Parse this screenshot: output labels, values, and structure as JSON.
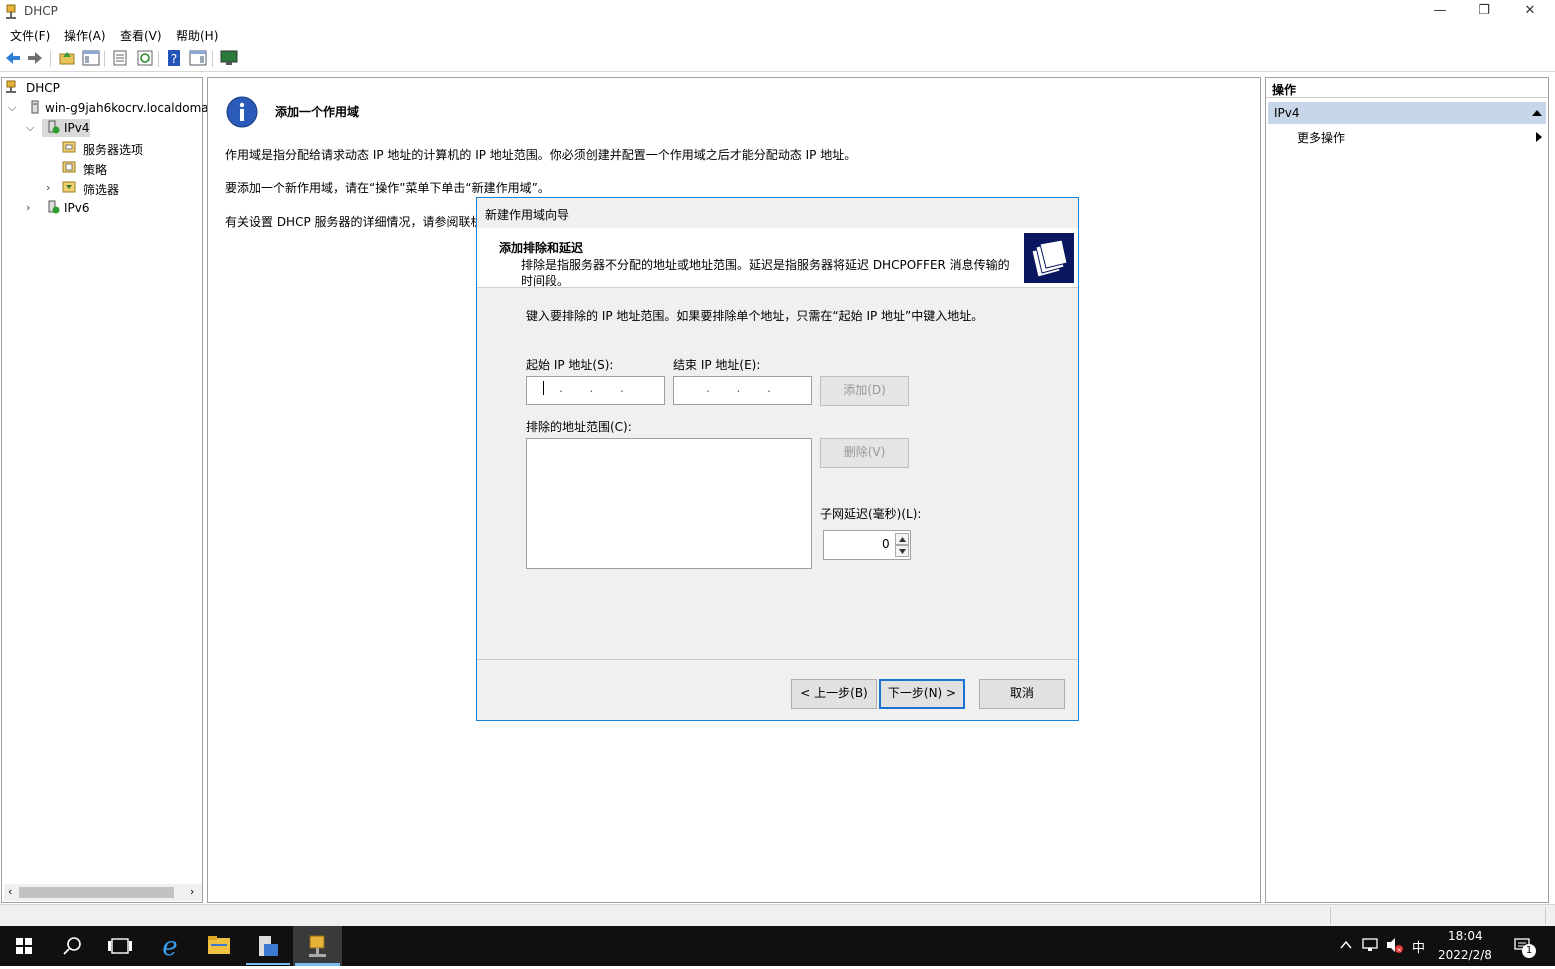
{
  "window": {
    "title": "DHCP",
    "controls": {
      "minimize": "—",
      "restore": "❐",
      "close": "✕"
    }
  },
  "menu": [
    "文件(F)",
    "操作(A)",
    "查看(V)",
    "帮助(H)"
  ],
  "tree": {
    "root": "DHCP",
    "server": "win-g9jah6kocrv.localdoma",
    "ipv4": "IPv4",
    "server_options": "服务器选项",
    "policies": "策略",
    "filters": "筛选器",
    "ipv6": "IPv6"
  },
  "center": {
    "heading": "添加一个作用域",
    "para1": "作用域是指分配给请求动态 IP 地址的计算机的 IP 地址范围。你必须创建并配置一个作用域之后才能分配动态 IP 地址。",
    "para2": "要添加一个新作用域，请在“操作”菜单下单击“新建作用域”。",
    "para3": "有关设置 DHCP 服务器的详细情况，请参阅联机"
  },
  "actions": {
    "title": "操作",
    "section": "IPv4",
    "more": "更多操作"
  },
  "dialog": {
    "title": "新建作用域向导",
    "header_title": "添加排除和延迟",
    "header_desc_line1": "排除是指服务器不分配的地址或地址范围。延迟是指服务器将延迟 DHCPOFFER 消息传输的",
    "header_desc_line2": "时间段。",
    "instruction": "键入要排除的 IP 地址范围。如果要排除单个地址，只需在“起始 IP 地址”中键入地址。",
    "start_ip_label": "起始 IP 地址(S):",
    "end_ip_label": "结束 IP 地址(E):",
    "ip_dots": ".       .       .",
    "add_button": "添加(D)",
    "excluded_label": "排除的地址范围(C):",
    "delete_button": "删除(V)",
    "delay_label": "子网延迟(毫秒)(L):",
    "delay_value": "0",
    "back_button": "< 上一步(B)",
    "next_button": "下一步(N) >",
    "cancel_button": "取消"
  },
  "taskbar": {
    "time": "18:04",
    "date": "2022/2/8",
    "ime": "中",
    "notification_count": "1"
  }
}
